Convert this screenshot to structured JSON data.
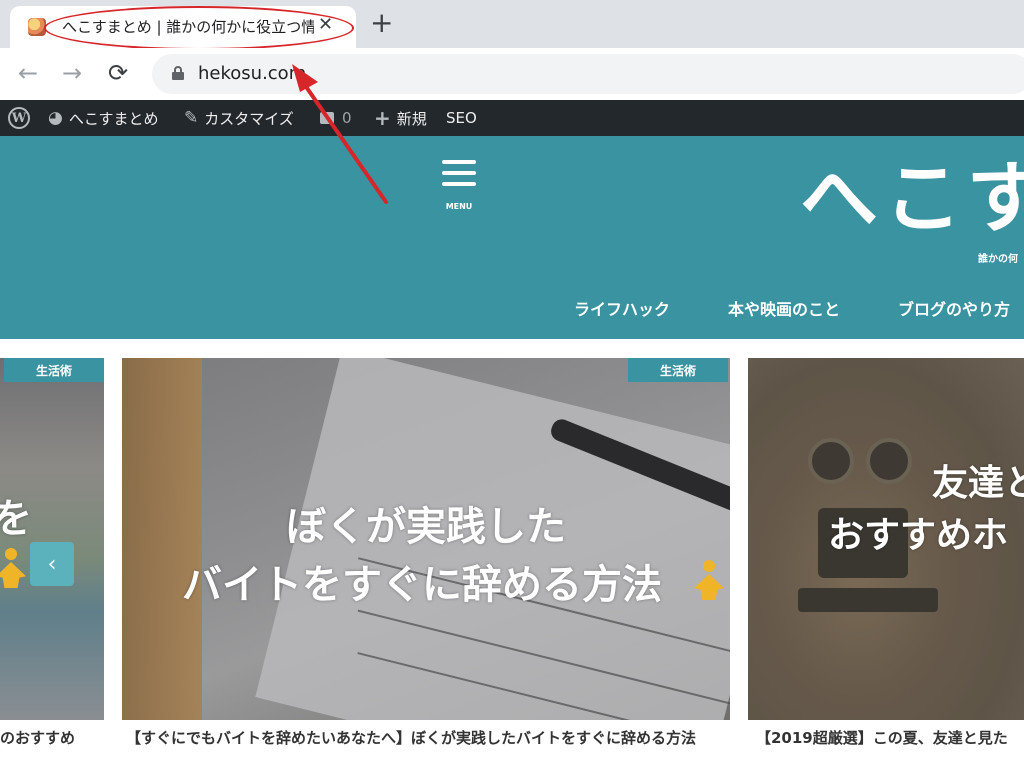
{
  "browser": {
    "tab_title": "へこすまとめ | 誰かの何かに役立つ情",
    "tab_close": "✕",
    "new_tab": "+",
    "url": "hekosu.com",
    "back_icon": "←",
    "forward_icon": "→",
    "reload_icon": "⟳"
  },
  "adminbar": {
    "wp_logo": "W",
    "site_name": "へこすまとめ",
    "customize": "カスタマイズ",
    "comments_count": "0",
    "new_label": "新規",
    "seo_label": "SEO"
  },
  "header": {
    "menu_label": "MENU",
    "site_title": "へこす",
    "tagline": "誰かの何",
    "nav": [
      "ライフハック",
      "本や映画のこと",
      "ブログのやり方"
    ]
  },
  "cards": {
    "left": {
      "badge": "生活術",
      "overlay": "を",
      "caption": "のおすすめ"
    },
    "center": {
      "badge": "生活術",
      "overlay_line1": "ぼくが実践した",
      "overlay_line2": "バイトをすぐに辞める方法",
      "caption": "【すぐにでもバイトを辞めたいあなたへ】ぼくが実践したバイトをすぐに辞める方法"
    },
    "right": {
      "overlay_line1": "友達と",
      "overlay_line2": "おすすめホ",
      "caption": "【2019超厳選】この夏、友達と見た"
    },
    "slider_prev": "‹"
  },
  "colors": {
    "brand_teal": "#3a93a0",
    "adminbar_bg": "#23282d",
    "annotation_red": "#d7262a"
  }
}
